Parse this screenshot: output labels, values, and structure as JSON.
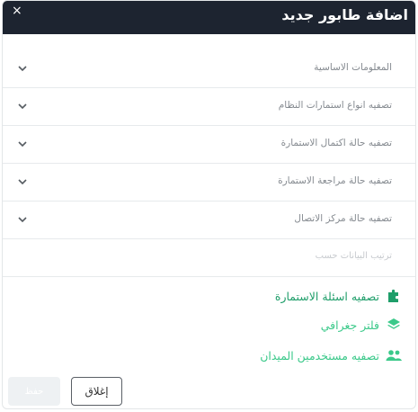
{
  "dialog": {
    "title": "اضافة طابور جديد",
    "close_symbol": "×"
  },
  "accordion": [
    {
      "label": "المعلومات الاساسية",
      "icon": "chevron-down-icon"
    },
    {
      "label": "تصفيه انواع استمارات النظام",
      "icon": "chevron-down-icon"
    },
    {
      "label": "تصفيه حالة اكتمال الاستمارة",
      "icon": "chevron-down-icon"
    },
    {
      "label": "تصفيه حالة مراجعة الاستمارة",
      "icon": "chevron-down-icon"
    },
    {
      "label": "تصفيه حالة مركز الاتصال",
      "icon": "chevron-down-icon"
    }
  ],
  "sort": {
    "label": "ترتيب البيانات حسب"
  },
  "links": [
    {
      "label": "تصفيه اسئلة الاستمارة",
      "icon": "puzzle-icon",
      "color": "#1f9e6a"
    },
    {
      "label": "فلتر جغرافي",
      "icon": "layers-icon",
      "color": "#3bc98a"
    },
    {
      "label": "تصفيه مستخدمين الميدان",
      "icon": "users-icon",
      "color": "#3bc98a"
    }
  ],
  "footer": {
    "close_label": "إغلاق",
    "save_label": "حفظ"
  },
  "colors": {
    "header_bg": "#1d2430",
    "accent": "#3bc98a",
    "accent_dark": "#1f9e6a"
  }
}
